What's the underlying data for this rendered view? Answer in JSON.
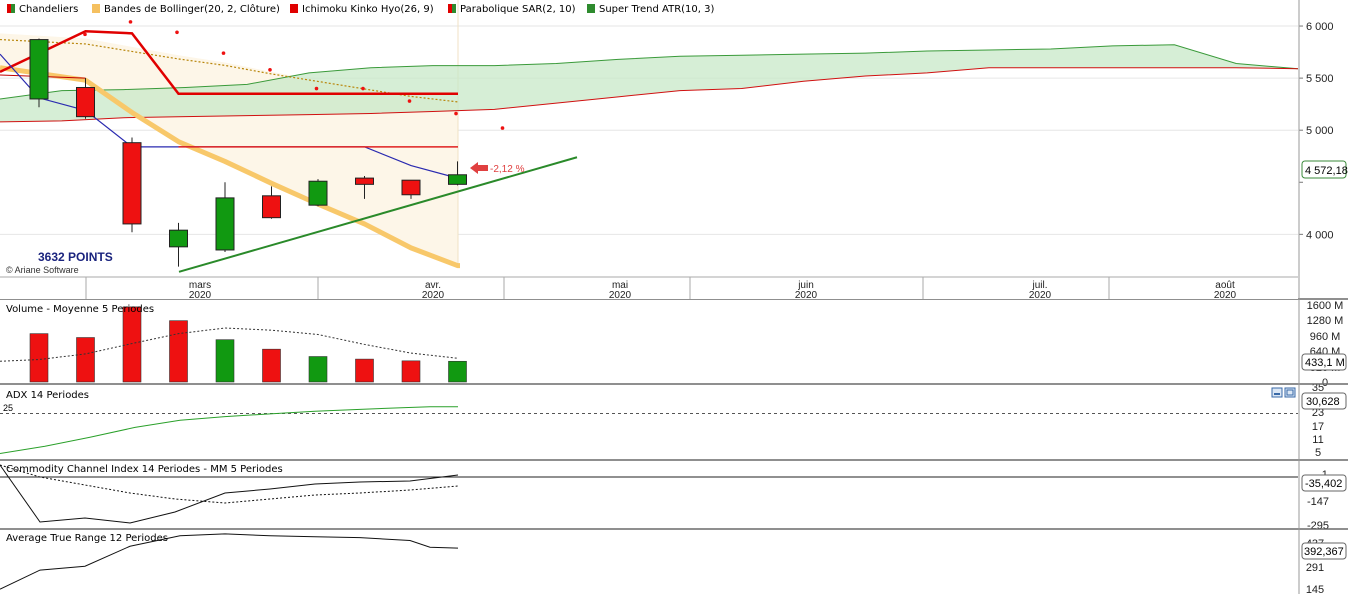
{
  "legend": [
    {
      "label": "Chandeliers",
      "color": "#2e8b2e",
      "color2": "#e00000"
    },
    {
      "label": "Bandes de Bollinger(20, 2, Clôture)",
      "color": "#f5c060"
    },
    {
      "label": "Ichimoku Kinko Hyo(26, 9)",
      "color": "#e00000"
    },
    {
      "label": "Parabolique SAR(2, 10)",
      "color": "#2e8b2e",
      "color2": "#e00000"
    },
    {
      "label": "Super Trend ATR(10, 3)",
      "color": "#2e8b2e"
    }
  ],
  "annotations": {
    "points_label": "3632 POINTS",
    "copyright": "© Ariane Software",
    "change_pct": "-2,12 %",
    "last_price": "4 572,18"
  },
  "x_axis": {
    "months": [
      {
        "label": "mars",
        "year": "2020"
      },
      {
        "label": "avr.",
        "year": "2020"
      },
      {
        "label": "mai",
        "year": "2020"
      },
      {
        "label": "juin",
        "year": "2020"
      },
      {
        "label": "juil.",
        "year": "2020"
      },
      {
        "label": "août",
        "year": "2020"
      }
    ]
  },
  "colors": {
    "up": "#119911",
    "down": "#ee1111",
    "bollinger": "#f8c86a",
    "cloud_green": "#c8e8c8",
    "kijun": "#e00000",
    "tenkan": "#2a2ab0",
    "trendline": "#2a8a2a"
  },
  "chart_data": [
    {
      "type": "candlestick",
      "title": "",
      "ylim": [
        3600,
        6250
      ],
      "ytick_labels": [
        "6 000",
        "5 500",
        "5 000",
        "4 000"
      ],
      "yticks": [
        6000,
        5500,
        5000,
        4000
      ],
      "candles": [
        {
          "o": 5300,
          "h": 5880,
          "l": 5220,
          "c": 5870
        },
        {
          "o": 5410,
          "h": 5500,
          "l": 5110,
          "c": 5130
        },
        {
          "o": 4880,
          "h": 4930,
          "l": 4020,
          "c": 4100
        },
        {
          "o": 3880,
          "h": 4110,
          "l": 3690,
          "c": 4040
        },
        {
          "o": 3850,
          "h": 4500,
          "l": 3830,
          "c": 4350
        },
        {
          "o": 4370,
          "h": 4460,
          "l": 4150,
          "c": 4160
        },
        {
          "o": 4280,
          "h": 4530,
          "l": 4270,
          "c": 4510
        },
        {
          "o": 4540,
          "h": 4560,
          "l": 4340,
          "c": 4480
        },
        {
          "o": 4520,
          "h": 4520,
          "l": 4340,
          "c": 4380
        },
        {
          "o": 4480,
          "h": 4700,
          "l": 4470,
          "c": 4572
        }
      ],
      "sar": [
        5920,
        6040,
        5940,
        5740,
        5580,
        5400,
        5400,
        5280,
        5160,
        5020
      ],
      "bollinger_upper": [
        5930,
        5880,
        5800,
        5720,
        5650,
        5560,
        5480,
        5400,
        5320,
        5260
      ],
      "bollinger_lower": [
        5600,
        5480,
        5170,
        4890,
        4700,
        4490,
        4290,
        4100,
        3870,
        3700
      ],
      "kijun": [
        5550,
        5550,
        5350,
        5350,
        5350,
        5350,
        5350,
        5350,
        5350,
        5350
      ],
      "tenkan": [
        5310,
        5190,
        4840,
        4840,
        4840,
        4840,
        4840,
        4840,
        4660,
        4540
      ],
      "cloud_a": [
        5300,
        5380,
        5390,
        5410,
        5440,
        5550,
        5600,
        5620,
        5620,
        5640,
        5680,
        5710,
        5720,
        5730,
        5740,
        5760,
        5770,
        5780,
        5810,
        5820,
        5640,
        5590
      ],
      "cloud_b": [
        5080,
        5090,
        5120,
        5130,
        5140,
        5150,
        5160,
        5180,
        5200,
        5260,
        5320,
        5380,
        5400,
        5470,
        5520,
        5550,
        5600,
        5600,
        5600,
        5600,
        5600,
        5590
      ],
      "trendline": {
        "from": [
          0,
          3640
        ],
        "to": [
          12.2,
          4740
        ]
      }
    },
    {
      "type": "bar",
      "title": "Volume - Moyenne 5 Periodes",
      "ylim": [
        0,
        1760
      ],
      "ytick_labels": [
        "1600 M",
        "1280 M",
        "960 M",
        "640 M",
        "320 M",
        "0"
      ],
      "values": [
        1120,
        1030,
        1740,
        1420,
        980,
        760,
        590,
        530,
        490,
        480
      ],
      "moving_avg": [
        520,
        650,
        890,
        1120,
        1250,
        1200,
        1100,
        870,
        670,
        550
      ],
      "last_value": "433,1 M"
    },
    {
      "type": "line",
      "title": "ADX 14 Periodes",
      "ylim": [
        0,
        40
      ],
      "ytick_labels": [
        "35",
        "29",
        "23",
        "17",
        "11",
        "5"
      ],
      "reference_label": "25",
      "values": [
        2.5,
        6.5,
        11.5,
        17,
        21,
        23,
        24.5,
        26,
        27,
        28,
        28.5,
        28.5
      ],
      "last_value": "30,628"
    },
    {
      "type": "line",
      "title": "Commodity Channel Index 14 Periodes - MM 5 Periodes",
      "ylim": [
        -310,
        15
      ],
      "ytick_labels": [
        "-1",
        "-147",
        "-295"
      ],
      "cci": [
        0,
        -285,
        -265,
        -290,
        -235,
        -140,
        -120,
        -95,
        -85,
        -80,
        -50
      ],
      "cci_ma": [
        0,
        -60,
        -100,
        -140,
        -170,
        -190,
        -170,
        -150,
        -140,
        -125,
        -105
      ],
      "last_value": "-35,402"
    },
    {
      "type": "line",
      "title": "Average True Range 12 Periodes",
      "ylim": [
        130,
        450
      ],
      "ytick_labels": [
        "437",
        "291",
        "145"
      ],
      "values": [
        145,
        245,
        265,
        370,
        425,
        435,
        425,
        420,
        415,
        400,
        365,
        360
      ],
      "last_value": "392,367"
    }
  ]
}
